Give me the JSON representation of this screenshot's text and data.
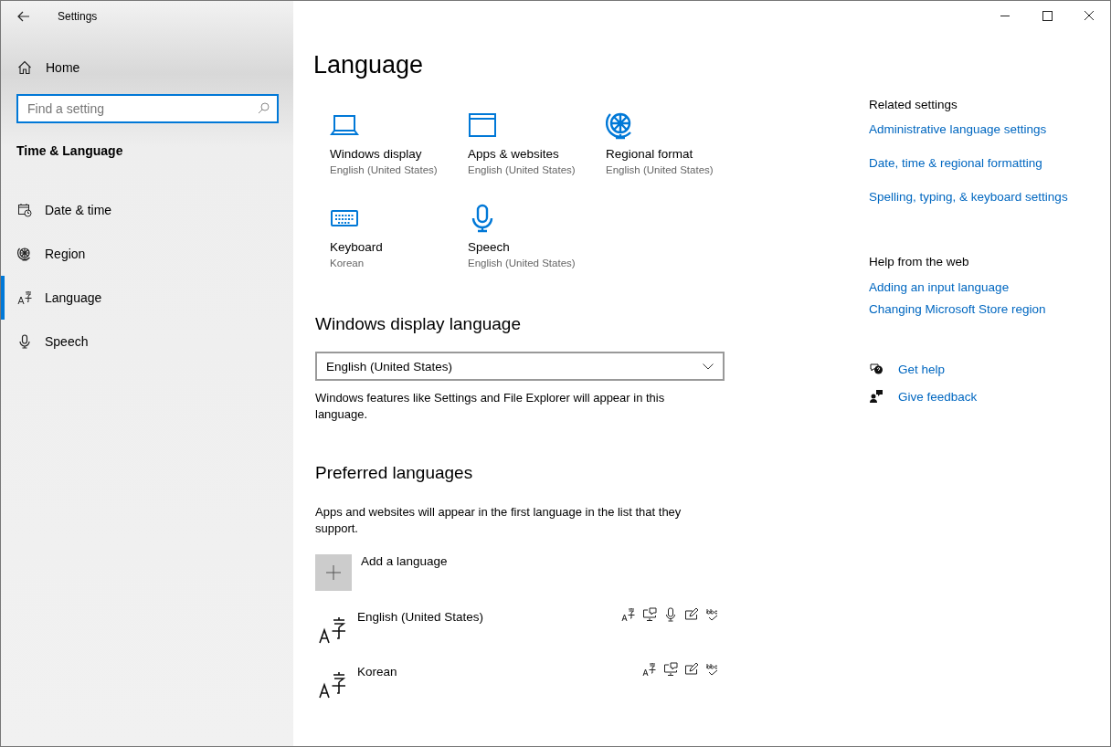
{
  "window": {
    "title": "Settings"
  },
  "sidebar": {
    "home": "Home",
    "search": {
      "placeholder": "Find a setting"
    },
    "section": "Time & Language",
    "items": [
      {
        "label": "Date & time",
        "kind": "calendar",
        "selected": false
      },
      {
        "label": "Region",
        "kind": "globe",
        "selected": false
      },
      {
        "label": "Language",
        "kind": "language",
        "selected": true
      },
      {
        "label": "Speech",
        "kind": "microphone",
        "selected": false
      }
    ]
  },
  "page": {
    "title": "Language",
    "tiles": [
      {
        "label": "Windows display",
        "value": "English (United States)",
        "kind": "laptop"
      },
      {
        "label": "Apps & websites",
        "value": "English (United States)",
        "kind": "window"
      },
      {
        "label": "Regional format",
        "value": "English (United States)",
        "kind": "globe"
      },
      {
        "label": "Keyboard",
        "value": "Korean",
        "kind": "keyboard"
      },
      {
        "label": "Speech",
        "value": "English (United States)",
        "kind": "microphone"
      }
    ],
    "display_language": {
      "heading": "Windows display language",
      "value": "English (United States)",
      "note": "Windows features like Settings and File Explorer will appear in this language."
    },
    "preferred": {
      "heading": "Preferred languages",
      "note": "Apps and websites will appear in the first language in the list that they support.",
      "add": "Add a language",
      "languages": [
        {
          "name": "English (United States)",
          "features": [
            {
              "kind": "language-pack"
            },
            {
              "kind": "display"
            },
            {
              "kind": "speech"
            },
            {
              "kind": "handwriting"
            },
            {
              "kind": "spelling"
            }
          ]
        },
        {
          "name": "Korean",
          "features": [
            {
              "kind": "language-pack"
            },
            {
              "kind": "display"
            },
            {
              "kind": "handwriting"
            },
            {
              "kind": "spelling"
            }
          ]
        }
      ]
    }
  },
  "related": {
    "heading": "Related settings",
    "links": [
      "Administrative language settings",
      "Date, time & regional formatting",
      "Spelling, typing, & keyboard settings"
    ]
  },
  "help": {
    "heading": "Help from the web",
    "links": [
      "Adding an input language",
      "Changing Microsoft Store region"
    ]
  },
  "support": [
    {
      "label": "Get help",
      "kind": "help"
    },
    {
      "label": "Give feedback",
      "kind": "feedback"
    }
  ]
}
